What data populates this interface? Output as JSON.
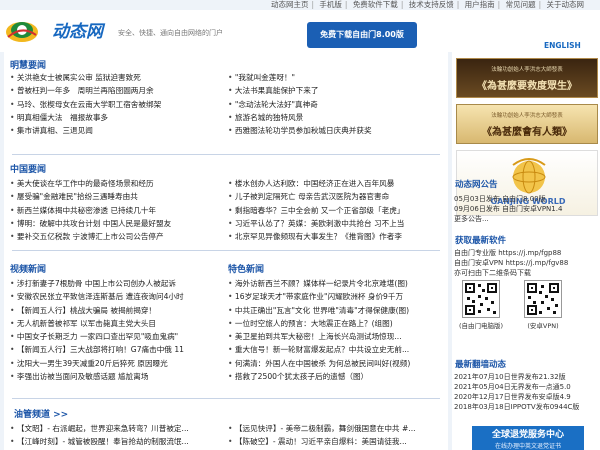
{
  "topnav": [
    "动态网主页",
    "手机版",
    "免费软件下载",
    "技术支持反馈",
    "用户指南",
    "常见问题",
    "关于动态网"
  ],
  "header": {
    "logo_text": "动态网",
    "slogan": "安全、快捷、通向自由网络的门户",
    "download_button": "免费下载自由门8.00版",
    "english": "ENGLISH"
  },
  "sections": {
    "hot": {
      "title": "明慧要闻",
      "left": [
        "关洪艳女士被属实公审 监狱迫害致死",
        "曾被枉判一年多　周明兰再陷囹圄两月余",
        "马玲、张楔母女在云南大学职工宿舍被绑架",
        "明真相僵大法　福报故事多",
        "集市讲真相、三退见闻"
      ],
      "right": [
        "\"我就叫金莲呀！\"",
        "大法书果真能保护下来了",
        "\"念动法轮大法好\"真神奇",
        "旅游名城的独特风景",
        "西雅图法轮功学员参加秋城日庆典并获奖"
      ]
    },
    "china": {
      "title": "中国要闻",
      "left": [
        "美大使谈在华工作中的最奇怪场景和经历",
        "屡受骗\"金融难民\"拾纷三遇睡寿由共",
        "新西兰媒体揭中共秘密渗透 已持续几十年",
        "博明：破解中共攻台计划 中国人民是最好盟友",
        "要补交五亿税款 宁波博汇上市公司公告停产"
      ],
      "right": [
        "楼水创办人达利欧：中国经济正在进入百年风暴",
        "儿子被判定隔死亡 母亲告武汉医院为器官害命",
        "剩指暗春华？三中全会前 又一个正省部级「老虎」",
        "习近平认怂了？英媒：美欧刺激中共抢台 习不上当",
        "北京罕见异像频现有大事发生？《推背图》作者李"
      ]
    },
    "video": {
      "title": "视频新闻",
      "items": [
        "涉打新妻子7根肋骨 中国上市公司创办人被起诉",
        "安徽农民张立平致信泽连斯基后 遭连夜询问4小时",
        "【新闻五人行】桃战大骗局 被揭前揭穿！",
        "无人机新普被祁军 以军击毙真主党大头目",
        "中国女子长期乏力 一家四口查出罕见\"吸血鬼病\"",
        "【新闻五人行】三大战部将打响！G7痛击中俄 11",
        "沈阳大一男生39天减重20斤后猝死 原因曝光",
        "李强出访被当面问及敏感话题 尴尬离场"
      ]
    },
    "feature": {
      "title": "特色新闻",
      "items": [
        "海外访新西兰不顾？媒体样一纪录片令北京难堪(图)",
        "16岁足球天才\"带家庭作业\"闪耀欧洲杯 身价9千万",
        "中共正确出\"瓦言\"文化 世界唯\"清毒\"才得保健康(图)",
        "一位时空旅人的预言：大地震正在路上？(组图)",
        "美卫星拍到共军大秘密！上海长兴岛测试场惊现...",
        "重大信号！新一轮财富爆发起点？中共设立史无前...",
        "何满清：外国人在中国被杀 为何总被民间叫好(视频)",
        "搭救了2500个犹太孩子后的遗憾（图）"
      ]
    },
    "pickmuch": {
      "title": "油管频道 >>",
      "rows": [
        [
          "【文昭】- 右派崛起，世界迎来急转弯？川普被定...",
          "【远见快评】- 美帝二极制霸，舞剑俄国意在中共 #..."
        ],
        [
          "【江峰时刻】- 城管被殴醒！奉旨抢劫的制服流氓...",
          "【陈破空】- 震动！习近平亲自爆料：美国请徒我..."
        ]
      ]
    }
  },
  "sidebar": {
    "ad1": {
      "small": "法輪功創始人李洪志大師發表",
      "main": "《為甚麼要救度眾生》"
    },
    "ad2": {
      "small": "法輪功創始人李洪志大師發表",
      "main": "《為甚麼會有人類》"
    },
    "ad3": {
      "main": "GANJING WORLD"
    },
    "bulletin_title": "动态网公告",
    "bulletin": [
      "05月03日发布 自由门8.00版",
      "09月06日发布 自由门安卓VPN1.4",
      "更多公告..."
    ],
    "software_title": "获取最新软件",
    "software": [
      "自由门专业版 https://j.mp/fgp88",
      "自由门安卓VPN https://j.mp/fgv88",
      "亦可扫由下二维条码下载"
    ],
    "qr_captions": [
      "(自由门电脑版)",
      "(安卓VPN)"
    ],
    "latest_title": "最新翻墙动态",
    "latest": [
      "2021年07月10日世界发布21.32版",
      "2021年05月04日无界发布一点通5.0",
      "2020年12月17日世界发布安卓版4.9",
      "2018年03月18日IPPOTV发布0944C版"
    ],
    "bottom_ad": {
      "main": "全球退党服务中心",
      "sub": "在线办理中英文退党证书"
    }
  },
  "colors": {
    "accent": "#1d56a8",
    "brand": "#1768c0",
    "button": "#1b5fb4",
    "bg": "#eef3f9"
  }
}
